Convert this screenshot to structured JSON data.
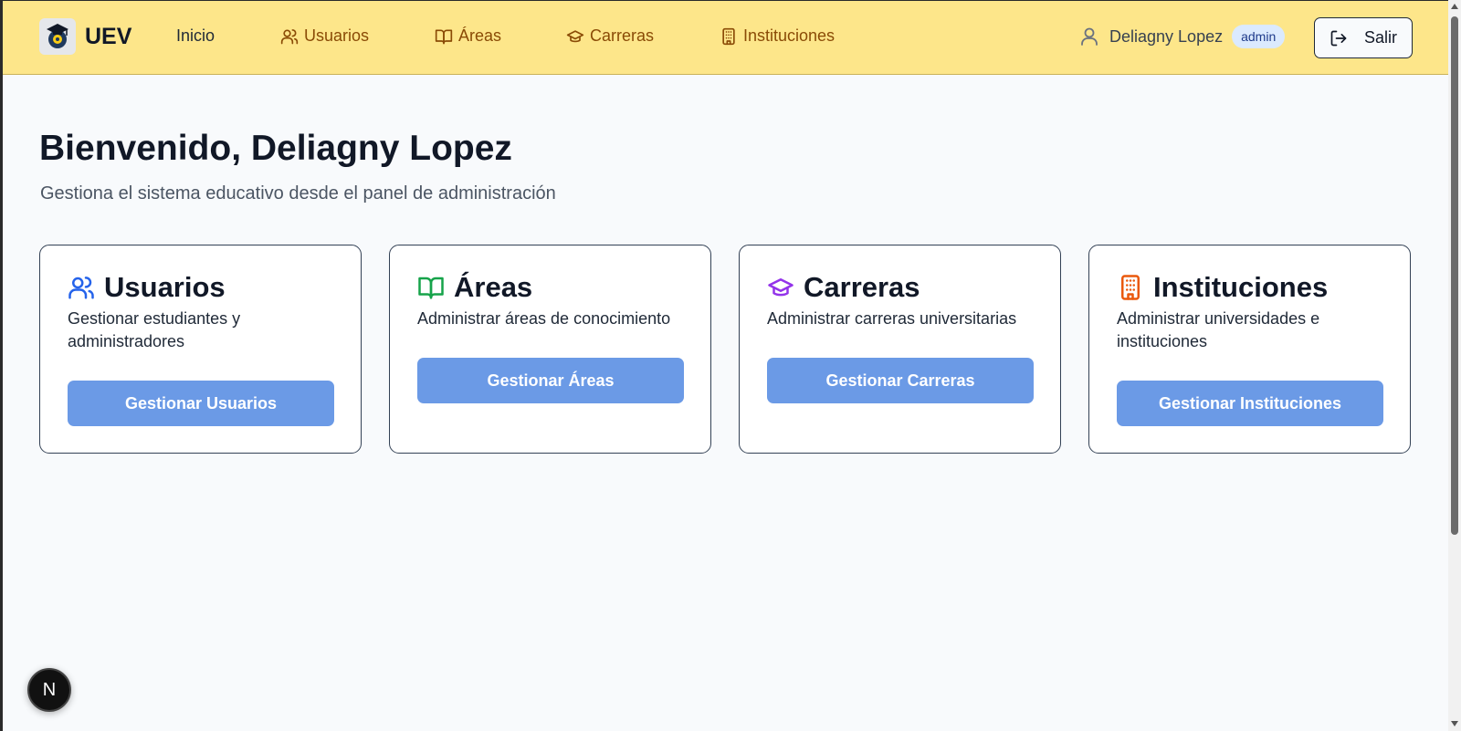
{
  "navbar": {
    "brand": "UEV",
    "links": [
      {
        "label": "Inicio"
      },
      {
        "label": "Usuarios"
      },
      {
        "label": "Áreas"
      },
      {
        "label": "Carreras"
      },
      {
        "label": "Instituciones"
      }
    ],
    "user_name": "Deliagny Lopez",
    "role": "admin",
    "logout_label": "Salir",
    "background_color": "#fde68a",
    "link_color": "#8a4b06"
  },
  "main": {
    "title": "Bienvenido, Deliagny Lopez",
    "subtitle": "Gestiona el sistema educativo desde el panel de administración",
    "cards": [
      {
        "icon": "users-icon",
        "icon_color": "#2563eb",
        "title": "Usuarios",
        "description": "Gestionar estudiantes y administradores",
        "button": "Gestionar Usuarios"
      },
      {
        "icon": "book-open-icon",
        "icon_color": "#16a34a",
        "title": "Áreas",
        "description": "Administrar áreas de conocimiento",
        "button": "Gestionar Áreas"
      },
      {
        "icon": "graduation-cap-icon",
        "icon_color": "#9333ea",
        "title": "Carreras",
        "description": "Administrar carreras universitarias",
        "button": "Gestionar Carreras"
      },
      {
        "icon": "building-icon",
        "icon_color": "#ea580c",
        "title": "Instituciones",
        "description": "Administrar universidades e instituciones",
        "button": "Gestionar Instituciones"
      }
    ],
    "button_color": "#6b9ae6"
  },
  "dev_badge": {
    "label": "N"
  }
}
